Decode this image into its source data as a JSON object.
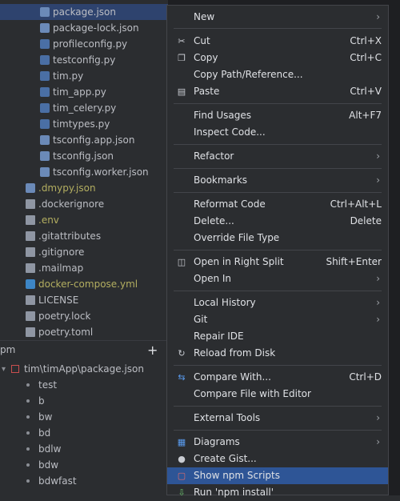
{
  "tree": {
    "items": [
      {
        "label": "package.json",
        "icon": "json-file-icon"
      },
      {
        "label": "package-lock.json",
        "icon": "json-file-icon"
      },
      {
        "label": "profileconfig.py",
        "icon": "python-file-icon"
      },
      {
        "label": "testconfig.py",
        "icon": "python-file-icon"
      },
      {
        "label": "tim.py",
        "icon": "python-file-icon"
      },
      {
        "label": "tim_app.py",
        "icon": "python-file-icon"
      },
      {
        "label": "tim_celery.py",
        "icon": "python-file-icon"
      },
      {
        "label": "timtypes.py",
        "icon": "python-file-icon"
      },
      {
        "label": "tsconfig.app.json",
        "icon": "json-file-icon"
      },
      {
        "label": "tsconfig.json",
        "icon": "json-file-icon"
      },
      {
        "label": "tsconfig.worker.json",
        "icon": "json-file-icon"
      },
      {
        "label": ".dmypy.json",
        "icon": "json-file-icon"
      },
      {
        "label": ".dockerignore",
        "icon": "file-icon"
      },
      {
        "label": ".env",
        "icon": "file-icon"
      },
      {
        "label": ".gitattributes",
        "icon": "file-icon"
      },
      {
        "label": ".gitignore",
        "icon": "file-icon"
      },
      {
        "label": ".mailmap",
        "icon": "file-icon"
      },
      {
        "label": "docker-compose.yml",
        "icon": "docker-file-icon"
      },
      {
        "label": "LICENSE",
        "icon": "file-icon"
      },
      {
        "label": "poetry.lock",
        "icon": "file-icon"
      },
      {
        "label": "poetry.toml",
        "icon": "file-icon"
      }
    ]
  },
  "npm": {
    "title": "pm",
    "root": "tim\\timApp\\package.json",
    "scripts": [
      "test",
      "b",
      "bw",
      "bd",
      "bdlw",
      "bdw",
      "bdwfast"
    ]
  },
  "menu": {
    "items": [
      {
        "label": "New",
        "shortcut": "",
        "sub": true
      },
      {
        "label": "Cut",
        "shortcut": "Ctrl+X",
        "icon": "scissors-icon"
      },
      {
        "label": "Copy",
        "shortcut": "Ctrl+C",
        "icon": "copy-icon"
      },
      {
        "label": "Copy Path/Reference...",
        "shortcut": ""
      },
      {
        "label": "Paste",
        "shortcut": "Ctrl+V",
        "icon": "paste-icon"
      },
      {
        "label": "Find Usages",
        "shortcut": "Alt+F7"
      },
      {
        "label": "Inspect Code...",
        "shortcut": ""
      },
      {
        "label": "Refactor",
        "shortcut": "",
        "sub": true
      },
      {
        "label": "Bookmarks",
        "shortcut": "",
        "sub": true
      },
      {
        "label": "Reformat Code",
        "shortcut": "Ctrl+Alt+L"
      },
      {
        "label": "Delete...",
        "shortcut": "Delete"
      },
      {
        "label": "Override File Type",
        "shortcut": ""
      },
      {
        "label": "Open in Right Split",
        "shortcut": "Shift+Enter",
        "icon": "split-icon"
      },
      {
        "label": "Open In",
        "shortcut": "",
        "sub": true
      },
      {
        "label": "Local History",
        "shortcut": "",
        "sub": true
      },
      {
        "label": "Git",
        "shortcut": "",
        "sub": true
      },
      {
        "label": "Repair IDE",
        "shortcut": ""
      },
      {
        "label": "Reload from Disk",
        "shortcut": "",
        "icon": "reload-icon"
      },
      {
        "label": "Compare With...",
        "shortcut": "Ctrl+D",
        "icon": "compare-icon"
      },
      {
        "label": "Compare File with Editor",
        "shortcut": ""
      },
      {
        "label": "External Tools",
        "shortcut": "",
        "sub": true
      },
      {
        "label": "Diagrams",
        "shortcut": "",
        "sub": true,
        "icon": "diagram-icon"
      },
      {
        "label": "Create Gist...",
        "shortcut": "",
        "icon": "github-icon"
      },
      {
        "label": "Show npm Scripts",
        "shortcut": "",
        "icon": "npm-icon"
      },
      {
        "label": "Run 'npm install'",
        "shortcut": "",
        "icon": "download-icon"
      }
    ]
  },
  "colors": {
    "selection": "#2e436e",
    "highlight": "#2e5596",
    "accent_yellow": "#b3ae60"
  }
}
